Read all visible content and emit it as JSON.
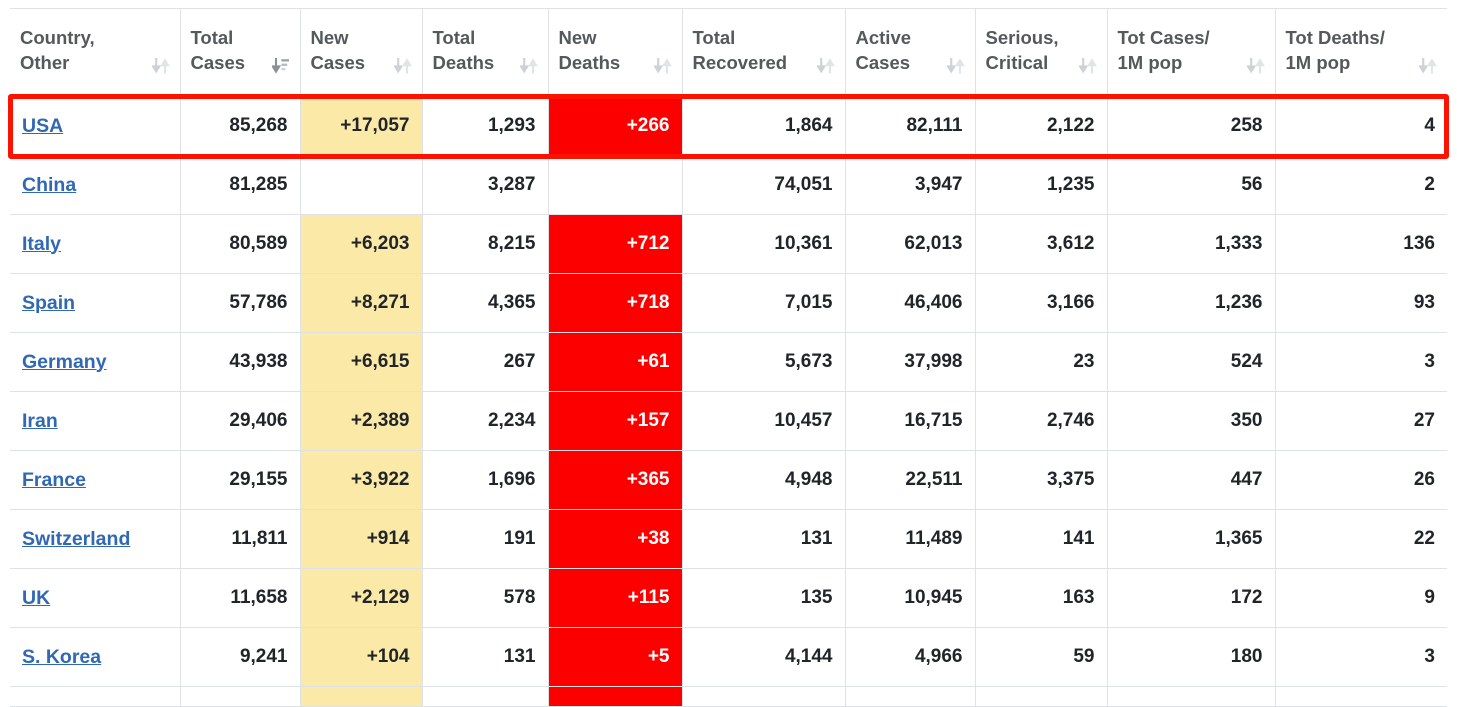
{
  "table": {
    "columns": [
      {
        "line1": "Country,",
        "line2": "Other",
        "sort_icon": "sort-both-icon",
        "sort_state": "none"
      },
      {
        "line1": "Total",
        "line2": "Cases",
        "sort_icon": "sort-descending-icon",
        "sort_state": "desc"
      },
      {
        "line1": "New",
        "line2": "Cases",
        "sort_icon": "sort-both-icon",
        "sort_state": "none"
      },
      {
        "line1": "Total",
        "line2": "Deaths",
        "sort_icon": "sort-both-icon",
        "sort_state": "none"
      },
      {
        "line1": "New",
        "line2": "Deaths",
        "sort_icon": "sort-both-icon",
        "sort_state": "none"
      },
      {
        "line1": "Total",
        "line2": "Recovered",
        "sort_icon": "sort-both-icon",
        "sort_state": "none"
      },
      {
        "line1": "Active",
        "line2": "Cases",
        "sort_icon": "sort-both-icon",
        "sort_state": "none"
      },
      {
        "line1": "Serious,",
        "line2": "Critical",
        "sort_icon": "sort-both-icon",
        "sort_state": "none"
      },
      {
        "line1": "Tot Cases/",
        "line2": "1M pop",
        "sort_icon": "sort-both-icon",
        "sort_state": "none"
      },
      {
        "line1": "Tot Deaths/",
        "line2": "1M pop",
        "sort_icon": "sort-both-icon",
        "sort_state": "none"
      }
    ],
    "rows": [
      {
        "country": "USA",
        "total_cases": "85,268",
        "new_cases": "+17,057",
        "total_deaths": "1,293",
        "new_deaths": "+266",
        "total_recovered": "1,864",
        "active_cases": "82,111",
        "serious_critical": "2,122",
        "tot_cases_1m": "258",
        "tot_deaths_1m": "4",
        "highlighted": true
      },
      {
        "country": "China",
        "total_cases": "81,285",
        "new_cases": "",
        "total_deaths": "3,287",
        "new_deaths": "",
        "total_recovered": "74,051",
        "active_cases": "3,947",
        "serious_critical": "1,235",
        "tot_cases_1m": "56",
        "tot_deaths_1m": "2",
        "highlighted": false
      },
      {
        "country": "Italy",
        "total_cases": "80,589",
        "new_cases": "+6,203",
        "total_deaths": "8,215",
        "new_deaths": "+712",
        "total_recovered": "10,361",
        "active_cases": "62,013",
        "serious_critical": "3,612",
        "tot_cases_1m": "1,333",
        "tot_deaths_1m": "136",
        "highlighted": false
      },
      {
        "country": "Spain",
        "total_cases": "57,786",
        "new_cases": "+8,271",
        "total_deaths": "4,365",
        "new_deaths": "+718",
        "total_recovered": "7,015",
        "active_cases": "46,406",
        "serious_critical": "3,166",
        "tot_cases_1m": "1,236",
        "tot_deaths_1m": "93",
        "highlighted": false
      },
      {
        "country": "Germany",
        "total_cases": "43,938",
        "new_cases": "+6,615",
        "total_deaths": "267",
        "new_deaths": "+61",
        "total_recovered": "5,673",
        "active_cases": "37,998",
        "serious_critical": "23",
        "tot_cases_1m": "524",
        "tot_deaths_1m": "3",
        "highlighted": false
      },
      {
        "country": "Iran",
        "total_cases": "29,406",
        "new_cases": "+2,389",
        "total_deaths": "2,234",
        "new_deaths": "+157",
        "total_recovered": "10,457",
        "active_cases": "16,715",
        "serious_critical": "2,746",
        "tot_cases_1m": "350",
        "tot_deaths_1m": "27",
        "highlighted": false
      },
      {
        "country": "France",
        "total_cases": "29,155",
        "new_cases": "+3,922",
        "total_deaths": "1,696",
        "new_deaths": "+365",
        "total_recovered": "4,948",
        "active_cases": "22,511",
        "serious_critical": "3,375",
        "tot_cases_1m": "447",
        "tot_deaths_1m": "26",
        "highlighted": false
      },
      {
        "country": "Switzerland",
        "total_cases": "11,811",
        "new_cases": "+914",
        "total_deaths": "191",
        "new_deaths": "+38",
        "total_recovered": "131",
        "active_cases": "11,489",
        "serious_critical": "141",
        "tot_cases_1m": "1,365",
        "tot_deaths_1m": "22",
        "highlighted": false
      },
      {
        "country": "UK",
        "total_cases": "11,658",
        "new_cases": "+2,129",
        "total_deaths": "578",
        "new_deaths": "+115",
        "total_recovered": "135",
        "active_cases": "10,945",
        "serious_critical": "163",
        "tot_cases_1m": "172",
        "tot_deaths_1m": "9",
        "highlighted": false
      },
      {
        "country": "S. Korea",
        "total_cases": "9,241",
        "new_cases": "+104",
        "total_deaths": "131",
        "new_deaths": "+5",
        "total_recovered": "4,144",
        "active_cases": "4,966",
        "serious_critical": "59",
        "tot_cases_1m": "180",
        "tot_deaths_1m": "3",
        "highlighted": false
      }
    ]
  },
  "annotation": {
    "target_row": "USA",
    "box_color": "#fc1200"
  },
  "colors": {
    "new_cases_bg": "#fbe9a7",
    "new_deaths_bg": "#fc0000",
    "link": "#3068b5",
    "border": "#dee2e6",
    "highlight": "#fc1200"
  }
}
